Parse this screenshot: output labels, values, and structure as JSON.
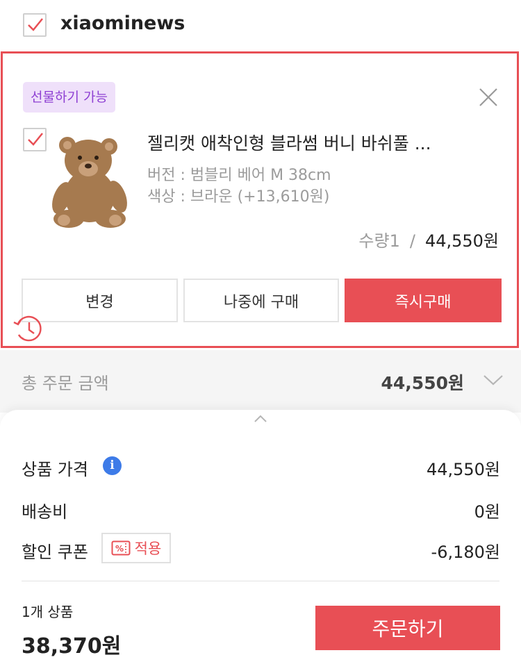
{
  "store": {
    "name": "xiaominews"
  },
  "product": {
    "gift_badge": "선물하기 가능",
    "name": "젤리캣 애착인형 블라썸 버니 바쉬풀 ...",
    "option_version": "버전 : 범블리 베어 M 38cm",
    "option_color": "색상 : 브라운 (+13,610원)",
    "quantity_label": "수량1",
    "separator": "/",
    "price": "44,550원",
    "image_icon": "teddy-bear-image"
  },
  "actions": {
    "change": "변경",
    "buy_later": "나중에 구매",
    "buy_now": "즉시구매"
  },
  "total": {
    "label": "총 주문 금액",
    "amount": "44,550원"
  },
  "summary": {
    "price_label": "상품 가격",
    "price_value": "44,550원",
    "info_icon": "i",
    "shipping_label": "배송비",
    "shipping_value": "0원",
    "coupon_label": "할인 쿠폰",
    "coupon_button": "적용",
    "coupon_value": "-6,180원",
    "item_count": "1개 상품",
    "final_amount": "38,370원",
    "order_button": "주문하기"
  },
  "colors": {
    "accent": "#e84f55",
    "gift_badge_bg": "#efe0fa",
    "gift_badge_text": "#8e3fd3",
    "info_blue": "#3d7be8"
  }
}
